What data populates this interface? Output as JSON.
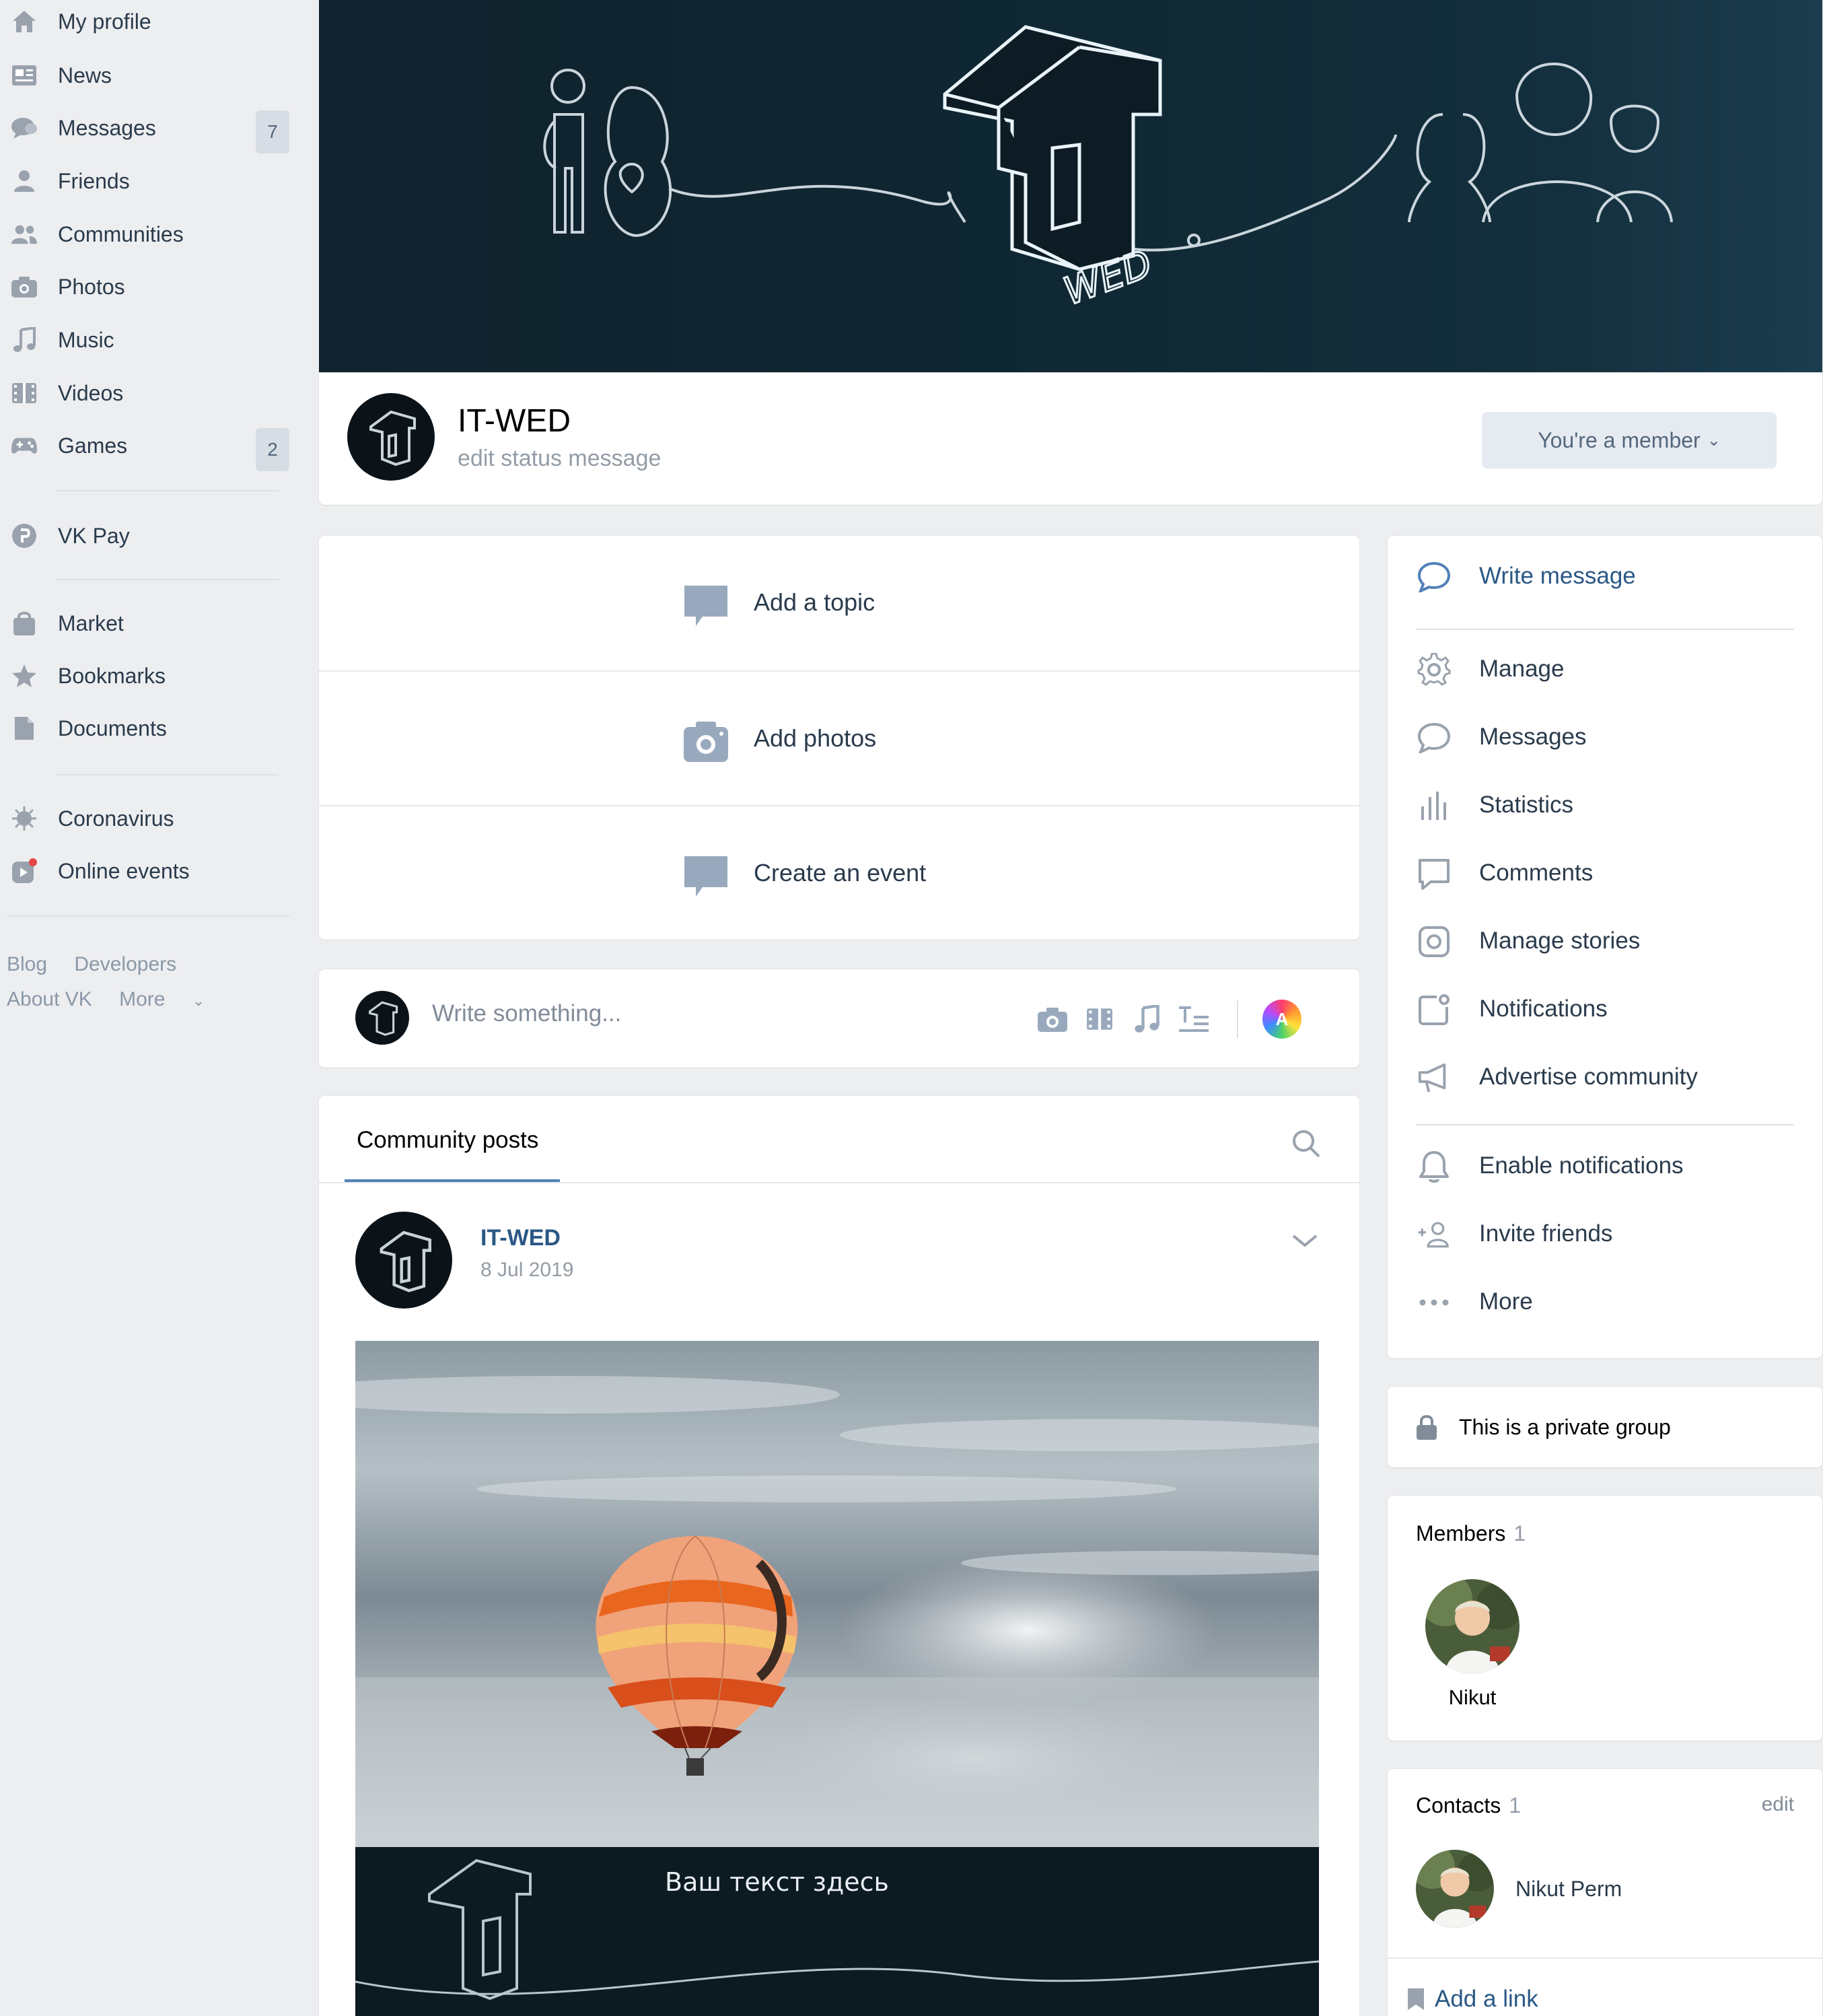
{
  "sidebar": {
    "items": [
      {
        "label": "My profile",
        "icon": "home-icon"
      },
      {
        "label": "News",
        "icon": "news-icon"
      },
      {
        "label": "Messages",
        "icon": "messages-icon",
        "count": "7"
      },
      {
        "label": "Friends",
        "icon": "friends-icon"
      },
      {
        "label": "Communities",
        "icon": "communities-icon"
      },
      {
        "label": "Photos",
        "icon": "camera-icon"
      },
      {
        "label": "Music",
        "icon": "music-icon"
      },
      {
        "label": "Videos",
        "icon": "video-icon"
      },
      {
        "label": "Games",
        "icon": "gamepad-icon",
        "count": "2"
      },
      {
        "label": "VK Pay",
        "icon": "vkpay-icon"
      },
      {
        "label": "Market",
        "icon": "bag-icon"
      },
      {
        "label": "Bookmarks",
        "icon": "star-icon"
      },
      {
        "label": "Documents",
        "icon": "document-icon"
      },
      {
        "label": "Coronavirus",
        "icon": "virus-icon"
      },
      {
        "label": "Online events",
        "icon": "online-events-icon"
      }
    ],
    "footer": {
      "blog": "Blog",
      "developers": "Developers",
      "about": "About VK",
      "more": "More"
    }
  },
  "cover": {
    "logo_text": "WED"
  },
  "group": {
    "name": "IT-WED",
    "status": "edit status message",
    "member_button": "You're a member"
  },
  "actions": [
    {
      "label": "Add a topic",
      "icon": "comment-icon"
    },
    {
      "label": "Add photos",
      "icon": "camera-icon"
    },
    {
      "label": "Create an event",
      "icon": "comment-icon"
    }
  ],
  "composer": {
    "placeholder": "Write something...",
    "poster_letter": "A"
  },
  "posts": {
    "tab": "Community posts",
    "post": {
      "author": "IT-WED",
      "date": "8 Jul 2019",
      "banner_text": "Ваш текст здесь"
    }
  },
  "menu": {
    "items": [
      {
        "label": "Write message",
        "icon": "chat-bubble-icon",
        "primary": true
      },
      {
        "label": "Manage",
        "icon": "gear-icon"
      },
      {
        "label": "Messages",
        "icon": "chat-bubble-icon"
      },
      {
        "label": "Statistics",
        "icon": "bar-chart-icon"
      },
      {
        "label": "Comments",
        "icon": "comment-square-icon"
      },
      {
        "label": "Manage stories",
        "icon": "stories-icon"
      },
      {
        "label": "Notifications",
        "icon": "notification-square-icon"
      },
      {
        "label": "Advertise community",
        "icon": "megaphone-icon"
      },
      {
        "label": "Enable notifications",
        "icon": "bell-icon"
      },
      {
        "label": "Invite friends",
        "icon": "add-user-icon"
      },
      {
        "label": "More",
        "icon": "more-icon"
      }
    ]
  },
  "private_group": "This is a private group",
  "members": {
    "title": "Members",
    "count": "1",
    "list": [
      {
        "name": "Nikut"
      }
    ]
  },
  "contacts": {
    "title": "Contacts",
    "count": "1",
    "edit": "edit",
    "list": [
      {
        "name": "Nikut Perm"
      }
    ],
    "add_link": "Add a link"
  },
  "colors": {
    "accent": "#5181b8",
    "link": "#2a5885",
    "background": "#edeef0",
    "icon": "#99a2ad"
  }
}
